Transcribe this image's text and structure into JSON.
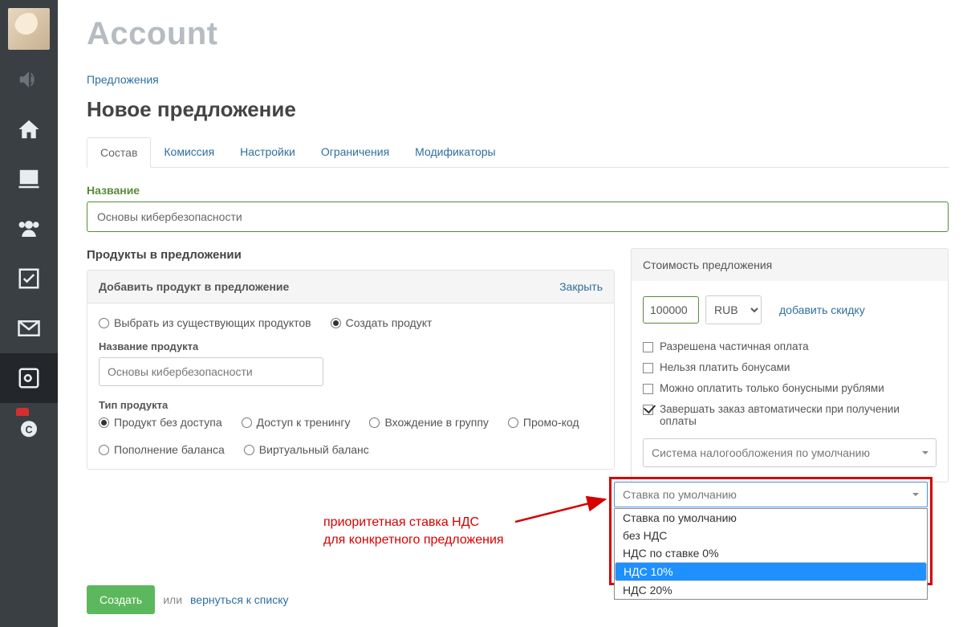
{
  "header": {
    "account": "Account"
  },
  "breadcrumb": "Предложения",
  "page_title": "Новое предложение",
  "tabs": [
    "Состав",
    "Комиссия",
    "Настройки",
    "Ограничения",
    "Модификаторы"
  ],
  "name_label": "Название",
  "name_value": "Основы кибербезопасности",
  "products": {
    "title": "Продукты в предложении",
    "add_title": "Добавить продукт в предложение",
    "close": "Закрыть",
    "mode_existing": "Выбрать из существующих продуктов",
    "mode_create": "Создать продукт",
    "product_name_label": "Название продукта",
    "product_name_value": "Основы кибербезопасности",
    "type_label": "Тип продукта",
    "types": [
      "Продукт без доступа",
      "Доступ к тренингу",
      "Вхождение в группу",
      "Промо-код",
      "Пополнение баланса",
      "Виртуальный баланс"
    ]
  },
  "cost": {
    "title": "Стоимость предложения",
    "price": "100000",
    "currency": "RUB",
    "add_discount": "добавить скидку",
    "chk_partial": "Разрешена частичная оплата",
    "chk_nobonus": "Нельзя платить бонусами",
    "chk_onlybonus": "Можно оплатить только бонусными рублями",
    "chk_autocomplete": "Завершать заказ автоматически при получении оплаты",
    "tax_system": "Система налогообложения по умолчанию"
  },
  "vat": {
    "selected": "Ставка по умолчанию",
    "options": [
      "Ставка по умолчанию",
      "без НДС",
      "НДС по ставке 0%",
      "НДС 10%",
      "НДС 20%"
    ],
    "highlighted_index": 3
  },
  "annotation": {
    "line1": "приоритетная ставка НДС",
    "line2": "для конкретного предложения"
  },
  "footer": {
    "create": "Создать",
    "or": "или",
    "back": "вернуться к списку"
  }
}
